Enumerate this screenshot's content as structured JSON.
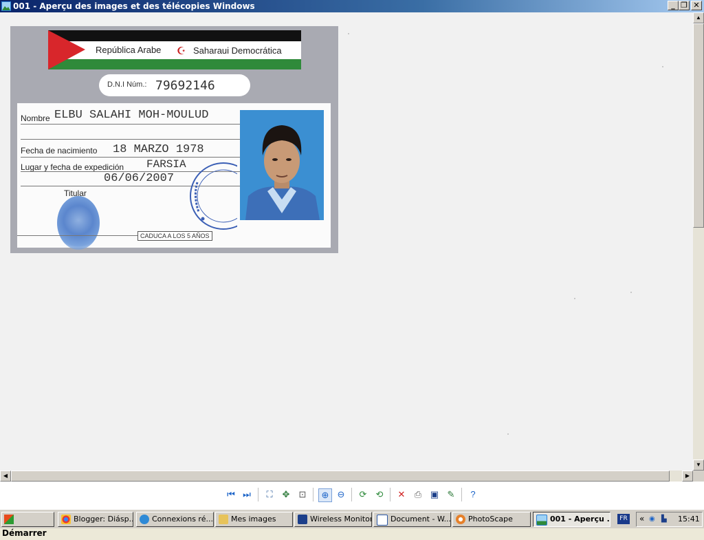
{
  "window": {
    "title": "001 - Aperçu des images et des télécopies Windows",
    "minimize": "_",
    "restore": "❐",
    "close": "✕"
  },
  "card": {
    "country_left": "República Arabe",
    "country_right": "Saharaui Democrática",
    "dni_label": "D.N.I Núm.:",
    "dni_value": "79692146",
    "nombre_label": "Nombre",
    "nombre_value": "ELBU SALAHI MOH-MOULUD",
    "nacimiento_label": "Fecha de nacimiento",
    "nacimiento_value": "18 MARZO 1978",
    "expedicion_label": "Lugar y fecha de expedición",
    "lugar_value": "FARSIA",
    "fecha_value": "06/06/2007",
    "titular_label": "Titular",
    "expiry_label": "CADUCA A LOS 5 AÑOS",
    "flag_colors": [
      "#111111",
      "#ffffff",
      "#2f8a3a",
      "#d8262b"
    ]
  },
  "toolbar": {
    "icons": [
      "previous-image-icon",
      "next-image-icon",
      "best-fit-icon",
      "actual-size-icon",
      "slideshow-icon",
      "zoom-in-icon",
      "zoom-out-icon",
      "rotate-clockwise-icon",
      "rotate-counterclockwise-icon",
      "delete-icon",
      "print-icon",
      "save-icon",
      "edit-icon",
      "help-icon"
    ]
  },
  "taskbar": {
    "start_label": "Démarrer",
    "tasks": [
      {
        "label": "Blogger: Diásp...",
        "icon": "chrome-icon"
      },
      {
        "label": "Connexions ré...",
        "icon": "network-icon"
      },
      {
        "label": "Mes images",
        "icon": "folder-icon"
      },
      {
        "label": "Wireless Monitor",
        "icon": "monitor-icon"
      },
      {
        "label": "Document - W...",
        "icon": "word-icon"
      },
      {
        "label": "PhotoScape",
        "icon": "photoscape-icon"
      },
      {
        "label": "001 - Aperçu ...",
        "icon": "image-viewer-icon"
      }
    ],
    "language": "FR",
    "tray_chevron": "«",
    "clock": "15:41"
  }
}
